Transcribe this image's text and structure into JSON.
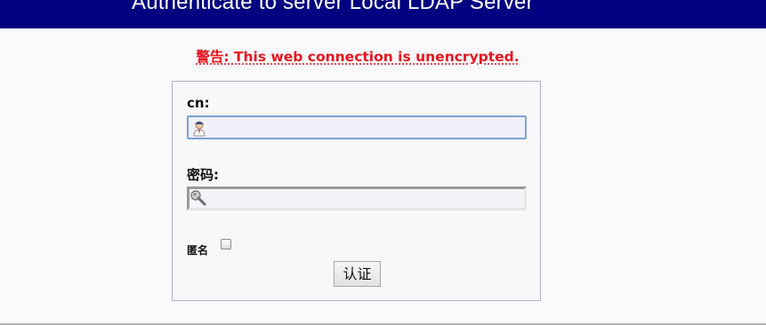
{
  "header": {
    "title": "Authenticate to server Local LDAP Server"
  },
  "warning": {
    "text": "警告: This web connection is unencrypted."
  },
  "form": {
    "cn_label": "cn:",
    "cn_value": "",
    "password_label": "密码:",
    "password_value": "",
    "anonymous_label": "匿名",
    "anonymous_checked": false,
    "submit_label": "认证"
  },
  "icons": {
    "cn_field_icon": "user-icon",
    "password_field_icon": "key-icon"
  },
  "colors": {
    "header_bg": "#000080",
    "warning_text": "#e8141e"
  }
}
